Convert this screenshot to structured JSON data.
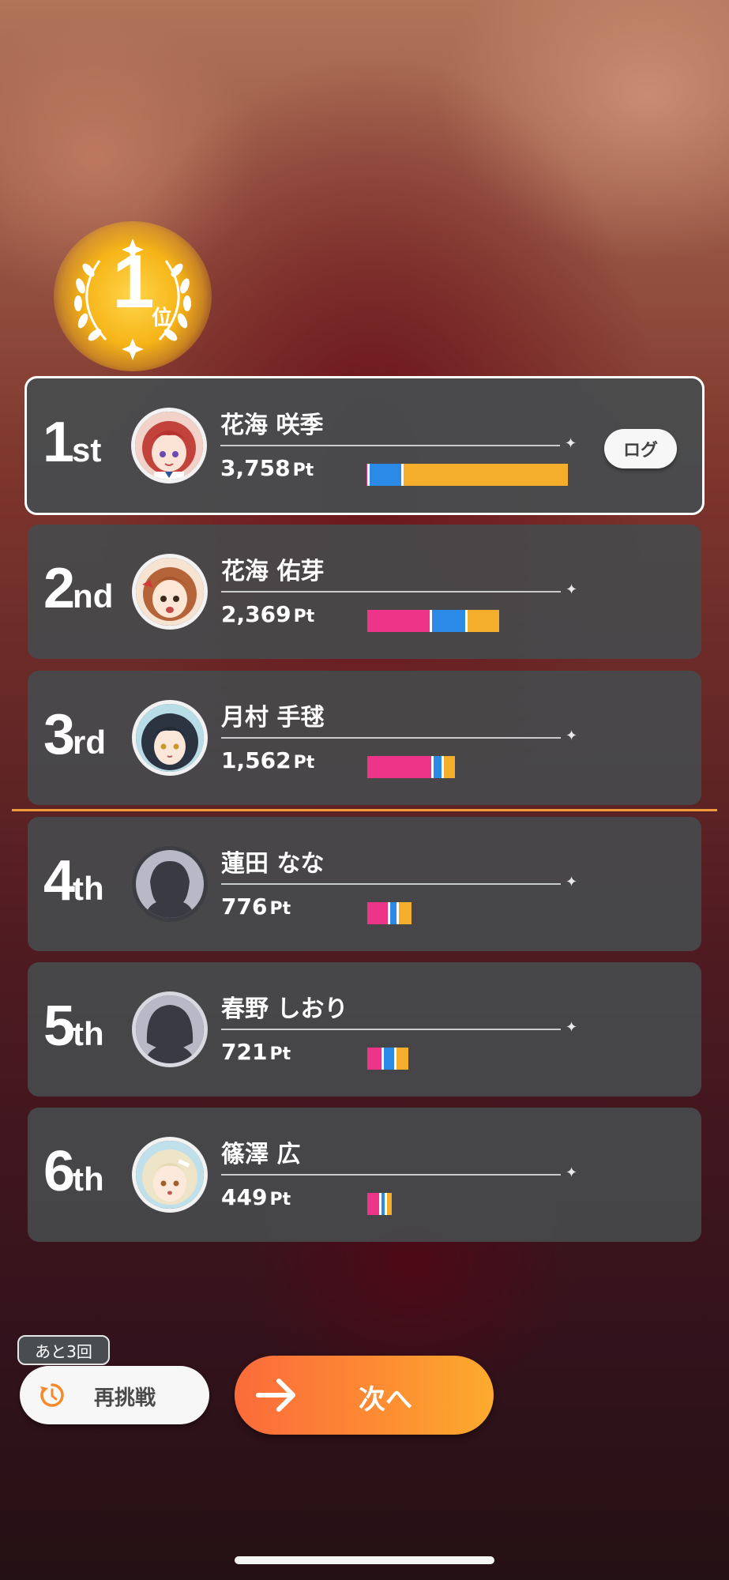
{
  "result": {
    "place_number": "1",
    "place_suffix": "位"
  },
  "ranking": [
    {
      "rank_num": "1",
      "rank_suffix": "st",
      "name": "花海 咲季",
      "points": "3,758",
      "unit": "Pt",
      "avatar": "character-portrait-red-hair",
      "bar": [
        {
          "color": "#ee3489",
          "value": 4
        },
        {
          "color": "#2b8ae6",
          "value": 43
        },
        {
          "color": "#f5ae2b",
          "value": 208
        }
      ]
    },
    {
      "rank_num": "2",
      "rank_suffix": "nd",
      "name": "花海 佑芽",
      "points": "2,369",
      "unit": "Pt",
      "avatar": "character-portrait-brown-hair",
      "bar": [
        {
          "color": "#ee3489",
          "value": 82
        },
        {
          "color": "#2b8ae6",
          "value": 45
        },
        {
          "color": "#f5ae2b",
          "value": 40
        }
      ]
    },
    {
      "rank_num": "3",
      "rank_suffix": "rd",
      "name": "月村 手毬",
      "points": "1,562",
      "unit": "Pt",
      "avatar": "character-portrait-dark-hair",
      "bar": [
        {
          "color": "#ee3489",
          "value": 84
        },
        {
          "color": "#2b8ae6",
          "value": 13
        },
        {
          "color": "#f5ae2b",
          "value": 14
        }
      ]
    },
    {
      "rank_num": "4",
      "rank_suffix": "th",
      "name": "蓮田 なな",
      "points": "776",
      "unit": "Pt",
      "avatar": "silhouette-placeholder",
      "bar": [
        {
          "color": "#ee3489",
          "value": 29
        },
        {
          "color": "#2b8ae6",
          "value": 11
        },
        {
          "color": "#f5ae2b",
          "value": 16
        }
      ]
    },
    {
      "rank_num": "5",
      "rank_suffix": "th",
      "name": "春野 しおり",
      "points": "721",
      "unit": "Pt",
      "avatar": "silhouette-placeholder",
      "bar": [
        {
          "color": "#ee3489",
          "value": 21
        },
        {
          "color": "#2b8ae6",
          "value": 16
        },
        {
          "color": "#f5ae2b",
          "value": 15
        }
      ]
    },
    {
      "rank_num": "6",
      "rank_suffix": "th",
      "name": "篠澤 広",
      "points": "449",
      "unit": "Pt",
      "avatar": "character-portrait-blonde-hair",
      "bar": [
        {
          "color": "#ee3489",
          "value": 18
        },
        {
          "color": "#2b8ae6",
          "value": 7
        },
        {
          "color": "#f5ae2b",
          "value": 6
        }
      ]
    }
  ],
  "log_button": "ログ",
  "retry": {
    "remaining": "あと3回",
    "label": "再挑戦"
  },
  "next": {
    "label": "次へ"
  },
  "colors": {
    "accent_orange": "#fd8b33",
    "highlight_border": "#ffffff"
  }
}
